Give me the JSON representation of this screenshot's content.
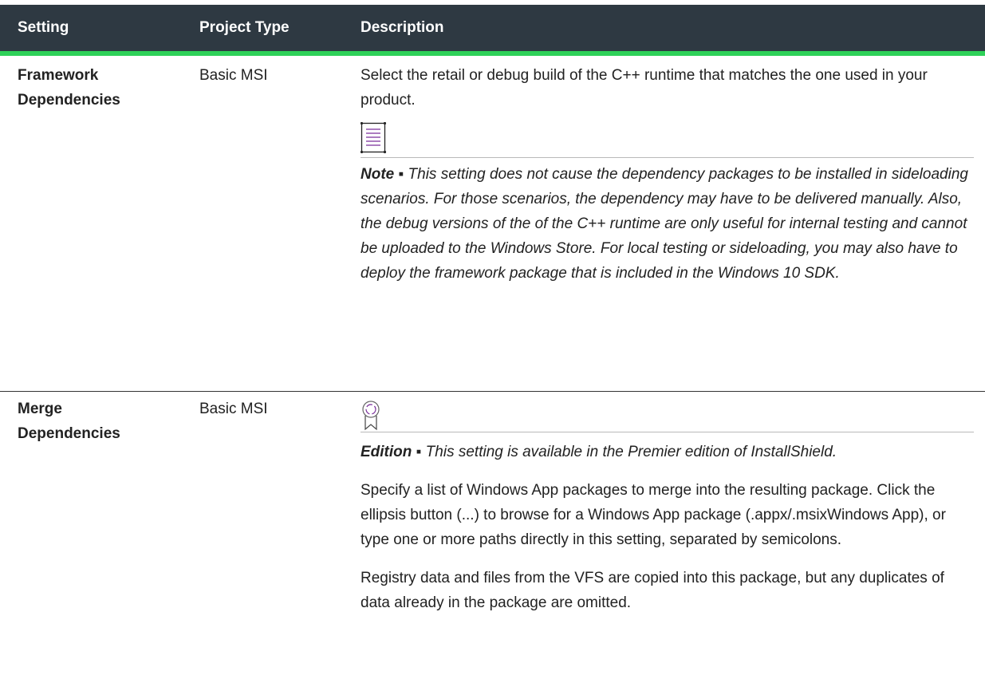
{
  "table": {
    "headers": {
      "setting": "Setting",
      "project_type": "Project Type",
      "description": "Description"
    },
    "rows": [
      {
        "setting_line1": "Framework",
        "setting_line2": "Dependencies",
        "project_type": "Basic MSI",
        "description": "Select the retail or debug build of the C++ runtime that matches the one used in your product.",
        "note_icon": "note-icon",
        "note_label": "Note ▪",
        "note_text": "This setting does not cause the dependency packages to be installed in sideloading scenarios. For those scenarios, the dependency may have to be delivered manually. Also, the debug versions of the of the C++ runtime are only useful for internal testing and cannot be uploaded to the Windows Store. For local testing or sideloading, you may also have to deploy the framework package that is included in the Windows 10 SDK."
      },
      {
        "setting_line1": "Merge",
        "setting_line2": "Dependencies",
        "project_type": "Basic MSI",
        "edition_icon": "award-ribbon-icon",
        "edition_label": "Edition ▪",
        "edition_text": "This setting is available in the Premier edition of InstallShield.",
        "description_para1": "Specify a list of Windows App packages to merge into the resulting package. Click the ellipsis button (...) to browse for a Windows App package (.appx/.msixWindows App), or type one or more paths directly in this setting, separated by semicolons.",
        "description_para2": "Registry data and files from the VFS are copied into this package, but any duplicates of data already in the package are omitted."
      }
    ]
  },
  "colors": {
    "header_bg": "#2e3942",
    "header_accent": "#2ed158",
    "note_icon_color": "#7a2e9a"
  }
}
